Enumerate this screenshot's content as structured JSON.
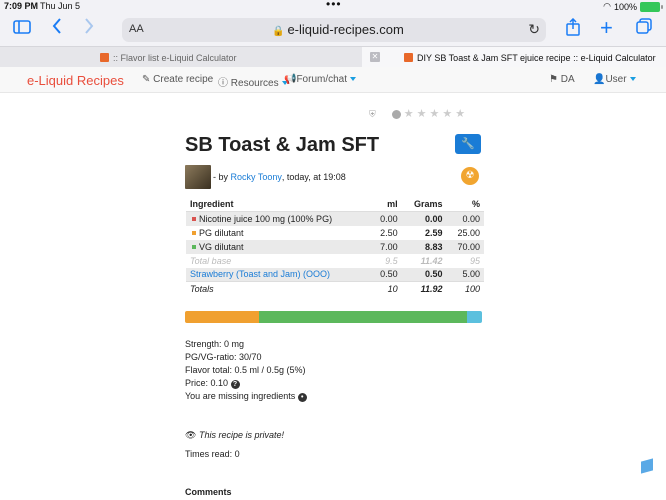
{
  "status": {
    "time": "7:09 PM",
    "date": "Thu Jun 5",
    "battery": "100%",
    "dots": "•••"
  },
  "browser": {
    "aa_label": "AA",
    "url": "e-liquid-recipes.com",
    "tabs": [
      {
        "label": ":: Flavor list e-Liquid Calculator"
      },
      {
        "label": "DIY SB Toast & Jam SFT ejuice recipe :: e-Liquid Calculator",
        "close": "✕"
      }
    ]
  },
  "navbar": {
    "brand": "e-Liquid Recipes",
    "create": "Create recipe",
    "resources": "Resources",
    "forum": "Forum/chat",
    "lang": "DA",
    "user": "User"
  },
  "recipe": {
    "title": "SB Toast & Jam SFT",
    "by_prefix": "- by",
    "author": "Rocky Toony",
    "when": ", today, at 19:08",
    "table": {
      "headers": [
        "Ingredient",
        "ml",
        "Grams",
        "%"
      ],
      "rows": [
        {
          "name": "Nicotine juice 100 mg (100% PG)",
          "ml": "0.00",
          "g": "0.00",
          "pct": "0.00",
          "color": "#d9534f"
        },
        {
          "name": "PG dilutant",
          "ml": "2.50",
          "g": "2.59",
          "pct": "25.00",
          "color": "#f0a030"
        },
        {
          "name": "VG dilutant",
          "ml": "7.00",
          "g": "8.83",
          "pct": "70.00",
          "color": "#5cb85c"
        }
      ],
      "total_base": {
        "name": "Total base",
        "ml": "9.5",
        "g": "11.42",
        "pct": "95"
      },
      "flavor": {
        "name": "Strawberry (Toast and Jam) (OOO)",
        "ml": "0.50",
        "g": "0.50",
        "pct": "5.00"
      },
      "totals": {
        "name": "Totals",
        "ml": "10",
        "g": "11.92",
        "pct": "100"
      }
    },
    "mix": [
      {
        "pct": 25,
        "color": "#f0a030"
      },
      {
        "pct": 70,
        "color": "#5cb85c"
      },
      {
        "pct": 5,
        "color": "#5bc0de"
      }
    ],
    "info": {
      "strength": "Strength: 0 mg",
      "ratio": "PG/VG-ratio: 30/70",
      "flavor_total": "Flavor total: 0.5 ml / 0.5g (5%)",
      "price": "Price: 0.10",
      "missing": "You are missing ingredients"
    },
    "private": "This recipe is private!",
    "times_read": "Times read: 0",
    "comments": "Comments"
  }
}
